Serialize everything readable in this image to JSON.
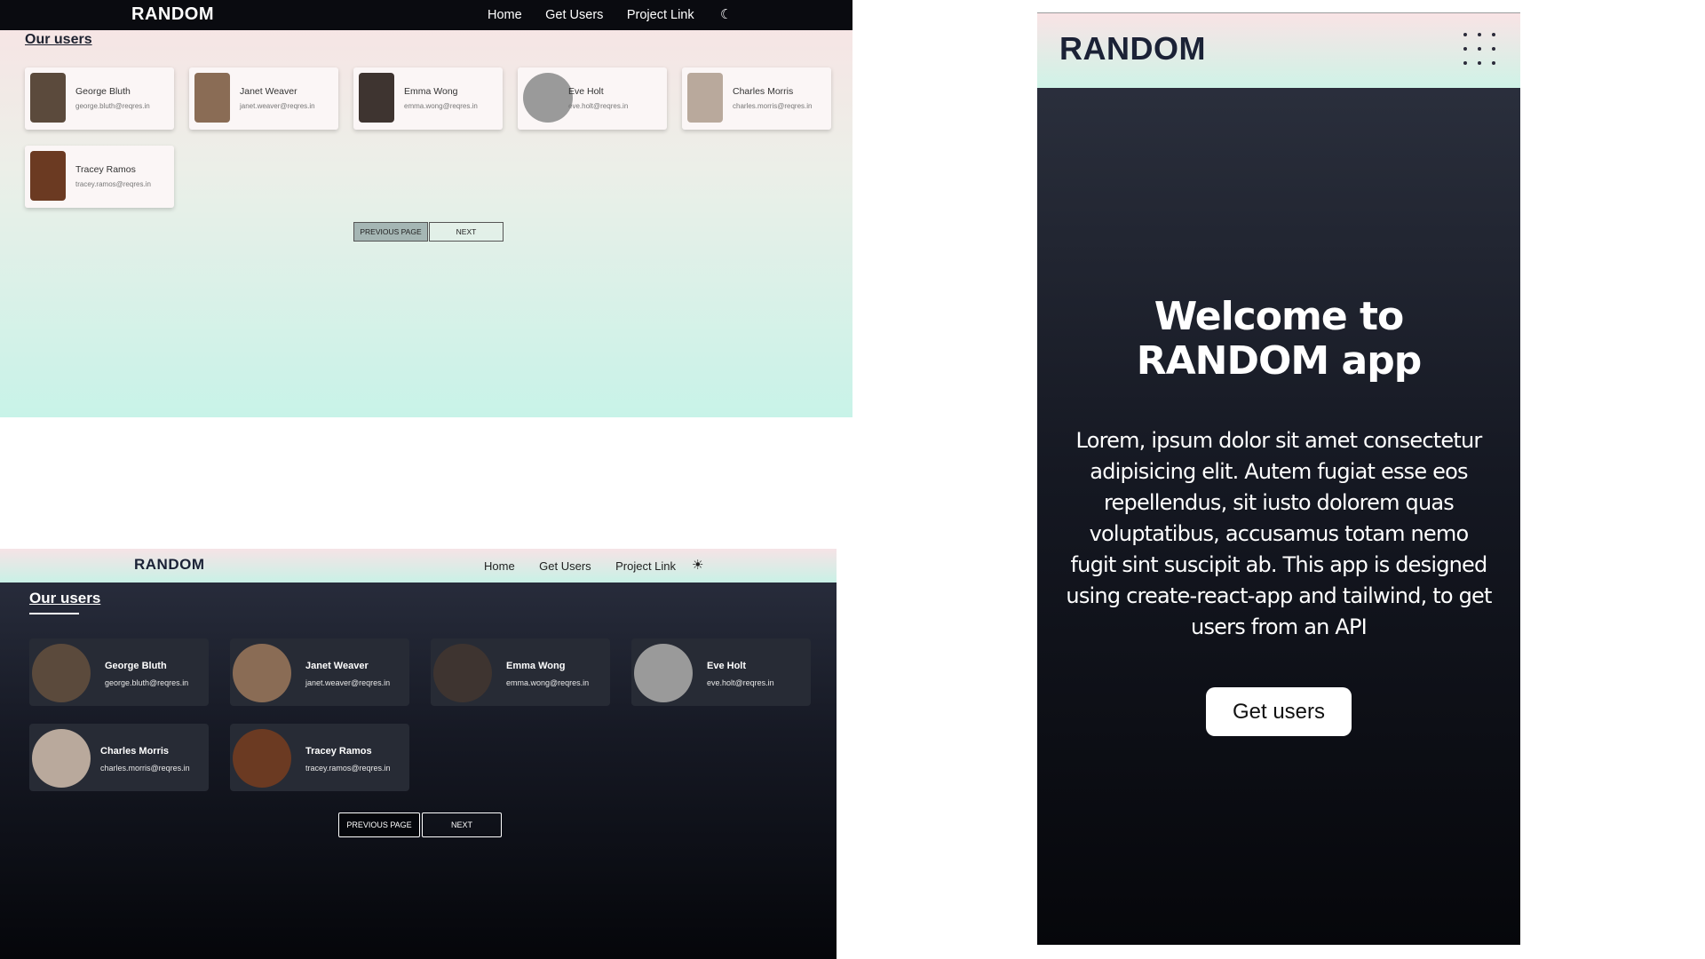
{
  "brand": "RANDOM",
  "nav": {
    "home": "Home",
    "get_users": "Get Users",
    "project_link": "Project Link"
  },
  "icons": {
    "light_theme_toggle": "moon-icon",
    "dark_theme_toggle": "sun-icon",
    "mobile_menu": "dots-grid-icon"
  },
  "users_heading": "Our users",
  "users": [
    {
      "name": "George Bluth",
      "email": "george.bluth@reqres.in",
      "avatar_color": "#5b4a3c"
    },
    {
      "name": "Janet Weaver",
      "email": "janet.weaver@reqres.in",
      "avatar_color": "#8a6c55"
    },
    {
      "name": "Emma Wong",
      "email": "emma.wong@reqres.in",
      "avatar_color": "#3e3430"
    },
    {
      "name": "Eve Holt",
      "email": "eve.holt@reqres.in",
      "avatar_color": "#9a9a9a"
    },
    {
      "name": "Charles Morris",
      "email": "charles.morris@reqres.in",
      "avatar_color": "#b9a99c"
    },
    {
      "name": "Tracey Ramos",
      "email": "tracey.ramos@reqres.in",
      "avatar_color": "#6b3a22"
    }
  ],
  "pagination": {
    "previous": "PREVIOUS PAGE",
    "next": "NEXT"
  },
  "mobile": {
    "title": "Welcome to RANDOM app",
    "description": "Lorem, ipsum dolor sit amet consectetur adipisicing elit. Autem fugiat esse eos repellendus, sit iusto dolorem quas voluptatibus, accusamus totam nemo fugit sint suscipit ab. This app is designed using create-react-app and tailwind, to get users from an API",
    "cta": "Get users"
  },
  "colors": {
    "light_nav_bg": "#0a0b10",
    "dark_card_bg": "#272b35",
    "gradient_pink": "#f8e3e4",
    "gradient_mint": "#c8f3e8"
  }
}
